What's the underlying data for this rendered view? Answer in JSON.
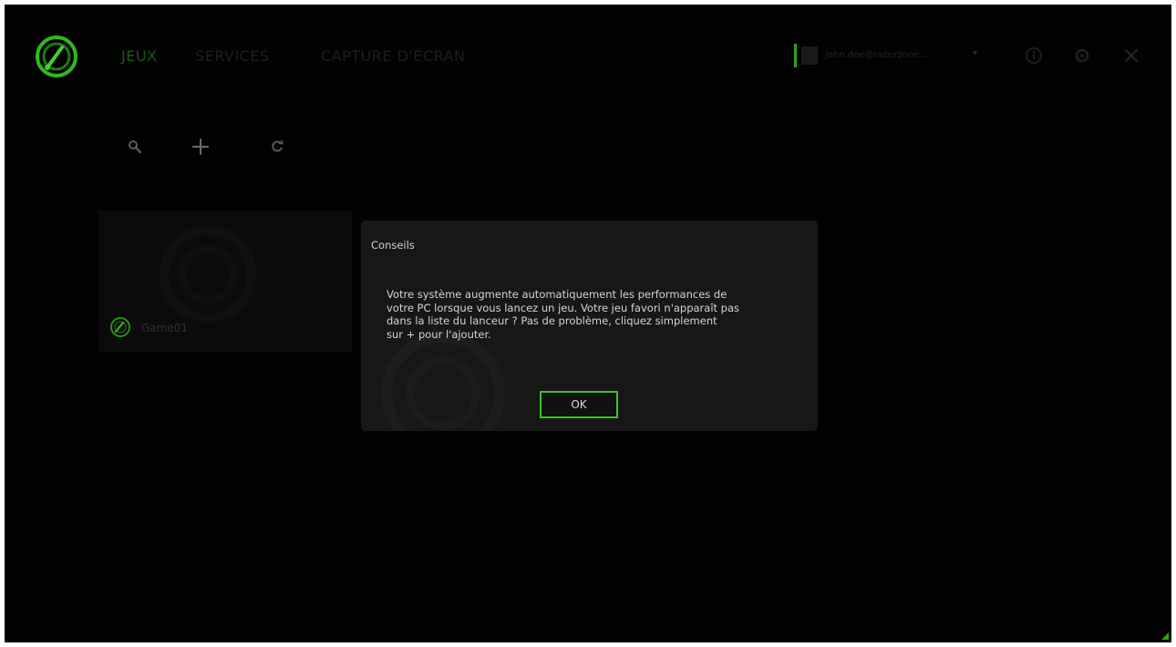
{
  "nav": {
    "tabs": [
      {
        "label": "JEUX",
        "active": true
      },
      {
        "label": "SERVICES",
        "active": false
      },
      {
        "label": "CAPTURE D'ÉCRAN",
        "active": false
      }
    ]
  },
  "account": {
    "name": "john.doe@razerzone....",
    "caret": "▾"
  },
  "window_controls": [
    "info-icon",
    "settings-icon",
    "close-icon"
  ],
  "toolbar": {
    "icons": [
      "search-icon",
      "add-icon",
      "refresh-icon"
    ]
  },
  "games": [
    {
      "name": "Game01"
    }
  ],
  "dialog": {
    "title": "Conseils",
    "message_lines": [
      "Votre système augmente automatiquement les performances de",
      "votre PC lorsque vous lancez un jeu.  Votre jeu favori n'apparaît pas",
      "dans la liste du lanceur ?  Pas de problème, cliquez simplement",
      "sur + pour l'ajouter."
    ],
    "ok_label": "OK"
  },
  "colors": {
    "accent": "#3ec42a",
    "background": "#020202",
    "dialog": "#171717"
  }
}
